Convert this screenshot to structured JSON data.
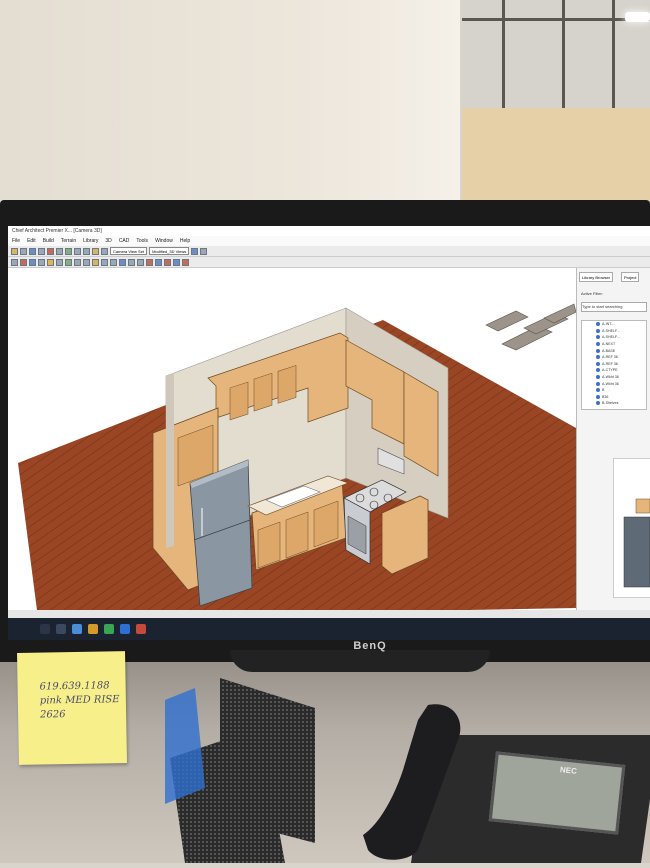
{
  "monitor": {
    "brand": "BenQ"
  },
  "app": {
    "title": "Chief Architect Premier X... [Camera 3D]",
    "menu": [
      "File",
      "Edit",
      "Build",
      "Terrain",
      "Library",
      "3D",
      "CAD",
      "Tools",
      "Window",
      "Help"
    ],
    "camera_select": "Camera View Set",
    "layer_select": "Modified_3D Views"
  },
  "library": {
    "tabs": [
      "Library Browser",
      "Project"
    ],
    "filter_label": "Active Filter:",
    "search_placeholder": "Type to start searching",
    "items": [
      "A-INT-...",
      "A-SHELF...",
      "A-SHELF...",
      "A-NEXT",
      "A-BASE",
      "A-REF 36",
      "A-REF 36",
      "A-CTYPE",
      "A-Wkht 36",
      "A-Wkht 36",
      "B",
      "B36",
      "B-Shelves"
    ]
  },
  "status": {
    "left": "",
    "right": ""
  },
  "sticky_note": {
    "lines": [
      "619.639.1188",
      "pink MED RISE",
      "2626"
    ]
  },
  "phone": {
    "brand": "NEC",
    "display_lines": [
      "",
      "",
      ""
    ]
  },
  "colors": {
    "floor": "#a34a28",
    "cabinet": "#e6b57b",
    "fridge": "#8a96a1",
    "wall": "#e7e1d4"
  }
}
